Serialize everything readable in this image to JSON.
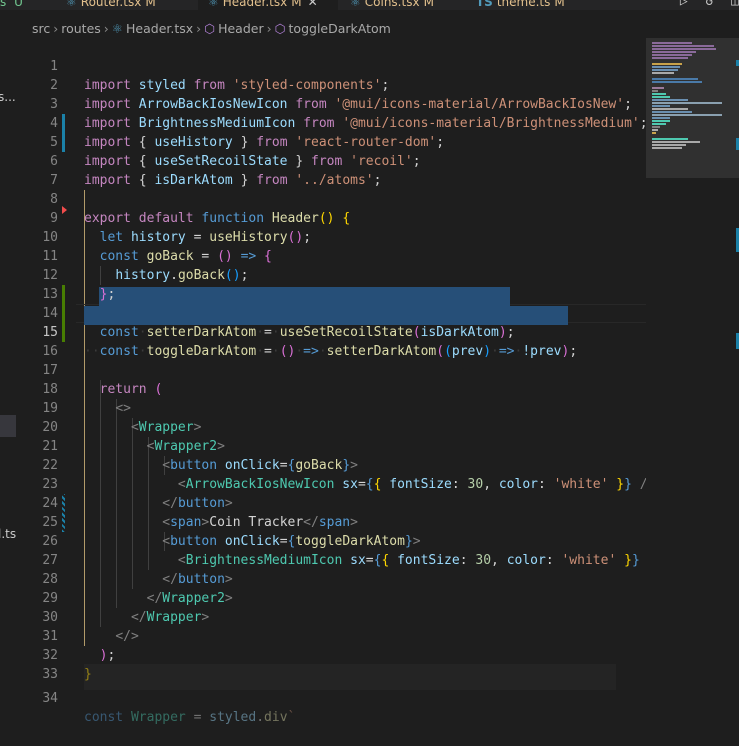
{
  "tabs": [
    {
      "label": "s",
      "modified_marker": "U"
    },
    {
      "label": "Router.tsx",
      "modified_marker": "M"
    },
    {
      "label": "Header.tsx",
      "modified_marker": "M",
      "active": true
    },
    {
      "label": "Coins.tsx",
      "modified_marker": "M"
    },
    {
      "label": "theme.ts",
      "modified_marker": "M"
    }
  ],
  "tab_actions": [
    "run-icon",
    "history-icon",
    "split-editor-icon"
  ],
  "breadcrumb": [
    "src",
    "routes",
    "Header.tsx",
    "Header",
    "toggleDarkAtom"
  ],
  "explorer_fragments": [
    "s...",
    "l.ts"
  ],
  "editor": {
    "current_line": "15",
    "lines": [
      {
        "n": "1"
      },
      {
        "n": "2"
      },
      {
        "n": "3"
      },
      {
        "n": "4"
      },
      {
        "n": "5"
      },
      {
        "n": "6"
      },
      {
        "n": "7"
      },
      {
        "n": "8"
      },
      {
        "n": "9"
      },
      {
        "n": "10"
      },
      {
        "n": "11"
      },
      {
        "n": "12"
      },
      {
        "n": "13"
      },
      {
        "n": "14"
      },
      {
        "n": "15"
      },
      {
        "n": "16"
      },
      {
        "n": "17"
      },
      {
        "n": "18"
      },
      {
        "n": "19"
      },
      {
        "n": "20"
      },
      {
        "n": "21"
      },
      {
        "n": "22"
      },
      {
        "n": "23"
      },
      {
        "n": "24"
      },
      {
        "n": "25"
      },
      {
        "n": "26"
      },
      {
        "n": "27"
      },
      {
        "n": "28"
      },
      {
        "n": "29"
      },
      {
        "n": "30"
      },
      {
        "n": "31"
      },
      {
        "n": "32"
      },
      {
        "n": "33"
      },
      {
        "n": "34"
      }
    ],
    "code": {
      "l1": [
        "import",
        "styled",
        "from",
        "'styled-components'",
        ";"
      ],
      "l2": [
        "import",
        "ArrowBackIosNewIcon",
        "from",
        "'@mui/icons-material/ArrowBackIosNew'",
        ";"
      ],
      "l3": [
        "import",
        "BrightnessMediumIcon",
        "from",
        "'@mui/icons-material/BrightnessMedium'",
        ";"
      ],
      "l4": [
        "import",
        "{",
        "useHistory",
        "}",
        "from",
        "'react-router-dom'",
        ";"
      ],
      "l5": [
        "import",
        "{",
        "useSetRecoilState",
        "}",
        "from",
        "'recoil'",
        ";"
      ],
      "l6": [
        "import",
        "{",
        "isDarkAtom",
        "}",
        "from",
        "'../atoms'",
        ";"
      ],
      "l8": [
        "export",
        "default",
        "function",
        "Header",
        "(",
        ")",
        "{"
      ],
      "l9": [
        "let",
        "history",
        "=",
        "useHistory",
        "(",
        ")",
        ";"
      ],
      "l10": [
        "const",
        "goBack",
        "=",
        "(",
        ")",
        "=>",
        "{"
      ],
      "l11": [
        "history",
        ".",
        "goBack",
        "(",
        ")",
        ";"
      ],
      "l12": [
        "}",
        ";"
      ],
      "l14": [
        "const",
        "setterDarkAtom",
        "=",
        "useSetRecoilState",
        "(",
        "isDarkAtom",
        ")",
        ";"
      ],
      "l15": [
        "const",
        "toggleDarkAtom",
        "=",
        "(",
        ")",
        "=>",
        "setterDarkAtom",
        "(",
        "(",
        "prev",
        ")",
        "=>",
        "!prev",
        ")",
        ";"
      ],
      "l17": [
        "return",
        "("
      ],
      "l18": [
        "<>"
      ],
      "l19": [
        "<",
        "Wrapper",
        ">"
      ],
      "l20": [
        "<",
        "Wrapper2",
        ">"
      ],
      "l21": [
        "<",
        "button",
        "onClick",
        "=",
        "{",
        "goBack",
        "}",
        ">"
      ],
      "l22": [
        "<",
        "ArrowBackIosNewIcon",
        "sx",
        "=",
        "{",
        "{",
        "fontSize",
        ":",
        "30",
        ",",
        "color",
        ":",
        "'white'",
        "}",
        "}",
        "/>"
      ],
      "l23": [
        "</",
        "button",
        ">"
      ],
      "l24": [
        "<",
        "span",
        ">",
        "Coin Tracker",
        "</",
        "span",
        ">"
      ],
      "l25": [
        "<",
        "button",
        "onClick",
        "=",
        "{",
        "toggleDarkAtom",
        "}",
        ">"
      ],
      "l26": [
        "<",
        "BrightnessMediumIcon",
        "sx",
        "=",
        "{",
        "{",
        "fontSize",
        ":",
        "30",
        ",",
        "color",
        ":",
        "'white'",
        "}",
        "}",
        "/"
      ],
      "l27": [
        "</",
        "button",
        ">"
      ],
      "l28": [
        "</",
        "Wrapper2",
        ">"
      ],
      "l29": [
        "</",
        "Wrapper",
        ">"
      ],
      "l30": [
        "</>"
      ],
      "l31": [
        ")",
        ";"
      ],
      "l32": [
        "}"
      ],
      "l34": [
        "const",
        "Wrapper",
        "=",
        "styled",
        ".",
        "div",
        "`"
      ]
    }
  },
  "colors": {
    "background": "#1e1e1e",
    "keyword": "#569cd6",
    "control_keyword": "#c586c0",
    "string": "#ce9178",
    "function": "#dcdcaa",
    "variable": "#9cdcfe",
    "component": "#4ec9b0",
    "selection": "#264f78",
    "git_modified": "#1b81a8",
    "git_added": "#487e02"
  }
}
